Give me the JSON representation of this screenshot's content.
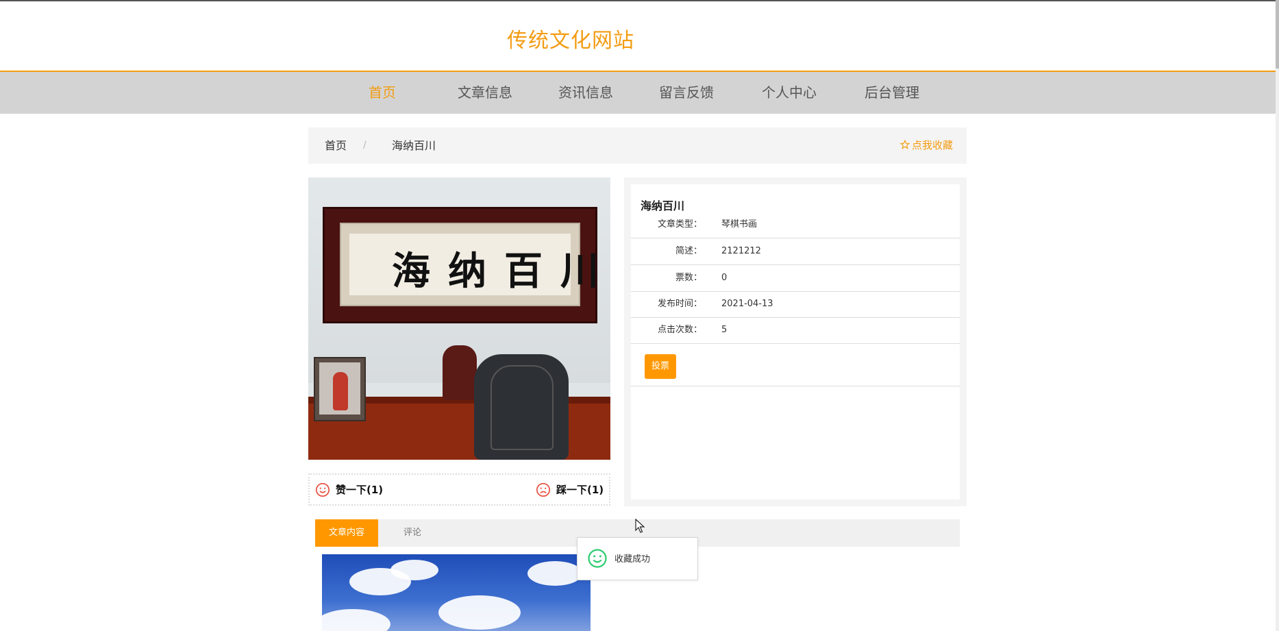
{
  "site": {
    "title": "传统文化网站"
  },
  "nav": {
    "items": [
      {
        "label": "首页",
        "active": true
      },
      {
        "label": "文章信息",
        "active": false
      },
      {
        "label": "资讯信息",
        "active": false
      },
      {
        "label": "留言反馈",
        "active": false
      },
      {
        "label": "个人中心",
        "active": false
      },
      {
        "label": "后台管理",
        "active": false
      }
    ]
  },
  "breadcrumb": {
    "home": "首页",
    "separator": "/",
    "current": "海纳百川",
    "favorite_label": "点我收藏",
    "favorite_icon": "star-outline-icon"
  },
  "article": {
    "image_calligraphy": "海纳百川",
    "like_label": "赞一下(1)",
    "dislike_label": "踩一下(1)",
    "title": "海纳百川",
    "fields": [
      {
        "key": "文章类型：",
        "value": "琴棋书画"
      },
      {
        "key": "简述：",
        "value": "2121212"
      },
      {
        "key": "票数：",
        "value": "0"
      },
      {
        "key": "发布时间：",
        "value": "2021-04-13"
      },
      {
        "key": "点击次数：",
        "value": "5"
      }
    ],
    "vote_button": "投票"
  },
  "tabs": [
    {
      "label": "文章内容",
      "active": true
    },
    {
      "label": "评论",
      "active": false
    }
  ],
  "toast": {
    "message": "收藏成功",
    "icon": "smile-icon"
  },
  "colors": {
    "accent": "#f39c12",
    "button": "#ff9800",
    "like_icon": "#e74c3c",
    "toast_icon": "#2ecc71"
  }
}
